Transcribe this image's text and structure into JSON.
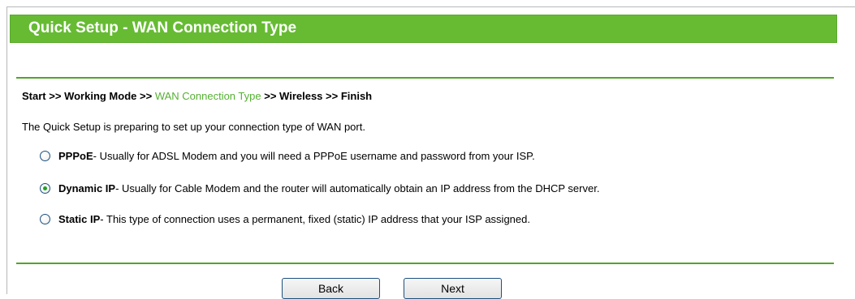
{
  "header": {
    "title": "Quick Setup - WAN Connection Type"
  },
  "breadcrumb": {
    "start": "Start",
    "sep1": ">>",
    "working_mode": "Working Mode",
    "sep2": ">>",
    "wan_connection_type": "WAN Connection Type",
    "sep3": ">>",
    "wireless": "Wireless",
    "sep4": ">>",
    "finish": "Finish"
  },
  "intro": "The Quick Setup is preparing to set up your connection type of WAN port.",
  "options": [
    {
      "name": "PPPoE",
      "description": " - Usually for ADSL Modem and you will need a PPPoE username and password from your ISP.",
      "selected": false
    },
    {
      "name": "Dynamic IP",
      "description": " - Usually for Cable Modem and the router will automatically obtain an IP address from the DHCP server.",
      "selected": true
    },
    {
      "name": "Static IP",
      "description": " - This type of connection uses a permanent, fixed (static) IP address that your ISP assigned.",
      "selected": false
    }
  ],
  "buttons": {
    "back": "Back",
    "next": "Next"
  },
  "colors": {
    "header_green": "#66bb33",
    "current_step": "#55b032",
    "rule": "#53a329"
  }
}
